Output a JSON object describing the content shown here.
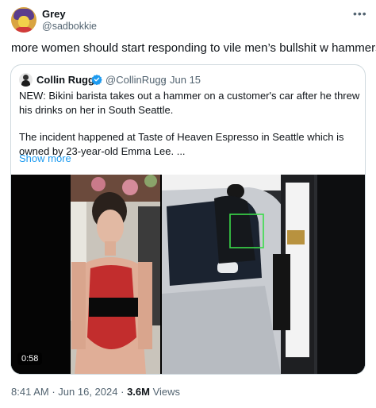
{
  "author": {
    "name": "Grey",
    "handle": "@sadbokkie"
  },
  "tweet": {
    "text": "more women should start responding to vile men’s bullshit w hammers"
  },
  "quoted": {
    "name": "Collin Rugg",
    "handle": "@CollinRugg",
    "separator": "·",
    "date": "Jun 15",
    "paragraph_1": "NEW: Bikini barista takes out a hammer on a customer's car after he threw his drinks on her in South Seattle.",
    "paragraph_2": "The incident happened at Taste of Heaven Espresso in Seattle which is owned by 23-year-old Emma Lee. ...",
    "show_more": "Show more",
    "video_duration": "0:58"
  },
  "footer": {
    "time": "8:41 AM",
    "separator": "·",
    "date": "Jun 16, 2024",
    "separator_2": "·",
    "views_count": "3.6M",
    "views_label": "Views"
  },
  "icons": {
    "more": "more-horizontal-icon",
    "verified": "verified-badge-icon"
  },
  "colors": {
    "link": "#1d9bf0",
    "secondary_text": "#536471",
    "verified_badge": "#1d9bf0"
  }
}
